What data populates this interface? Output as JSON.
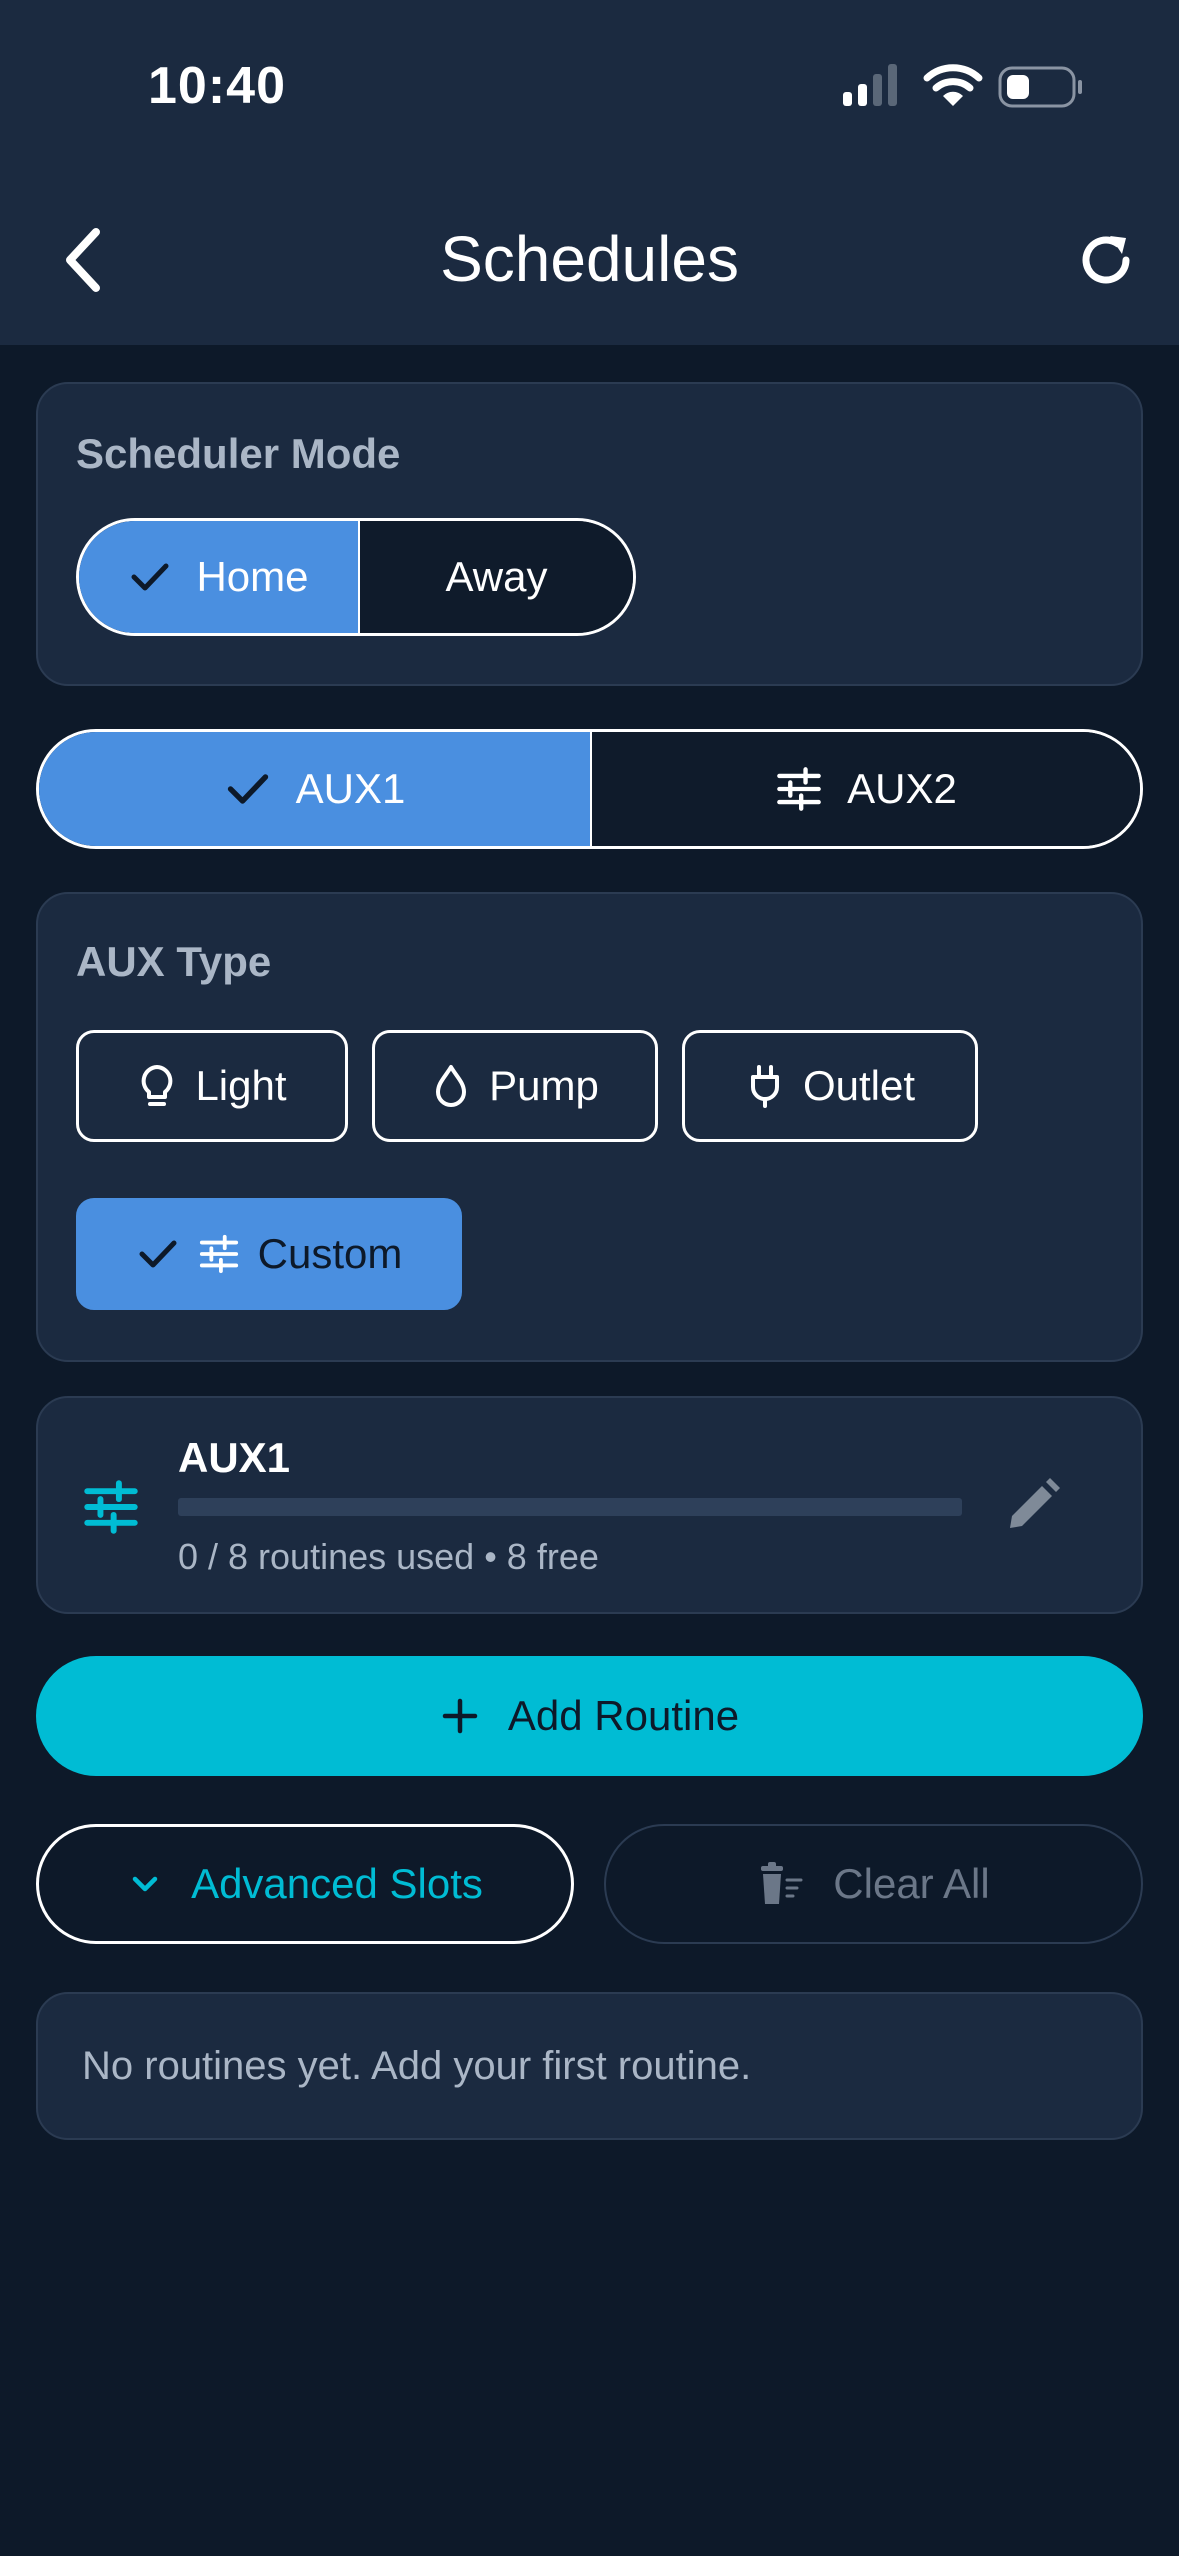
{
  "status_bar": {
    "time": "10:40"
  },
  "nav": {
    "title": "Schedules",
    "back_icon": "chevron-left-icon",
    "refresh_icon": "refresh-icon"
  },
  "scheduler_mode": {
    "label": "Scheduler Mode",
    "options": [
      {
        "label": "Home",
        "selected": true
      },
      {
        "label": "Away",
        "selected": false
      }
    ]
  },
  "aux_tabs": [
    {
      "label": "AUX1",
      "selected": true,
      "icon": "check-icon"
    },
    {
      "label": "AUX2",
      "selected": false,
      "icon": "sliders-icon"
    }
  ],
  "aux_type": {
    "label": "AUX Type",
    "options": [
      {
        "label": "Light",
        "icon": "lightbulb-icon",
        "selected": false
      },
      {
        "label": "Pump",
        "icon": "water-drop-icon",
        "selected": false
      },
      {
        "label": "Outlet",
        "icon": "plug-icon",
        "selected": false
      },
      {
        "label": "Custom",
        "icon": "sliders-icon",
        "selected": true
      }
    ]
  },
  "aux_summary": {
    "name": "AUX1",
    "usage_text": "0 / 8 routines used • 8 free",
    "used": 0,
    "total": 8,
    "icon": "sliders-icon",
    "edit_icon": "pencil-icon"
  },
  "actions": {
    "add_routine": "Add Routine",
    "advanced_slots": "Advanced Slots",
    "clear_all": "Clear All"
  },
  "empty_state": "No routines yet. Add your first routine.",
  "colors": {
    "accent_blue": "#4a8fe0",
    "accent_cyan": "#00bcd4",
    "background": "#0d1929",
    "card": "#1b2a40"
  }
}
